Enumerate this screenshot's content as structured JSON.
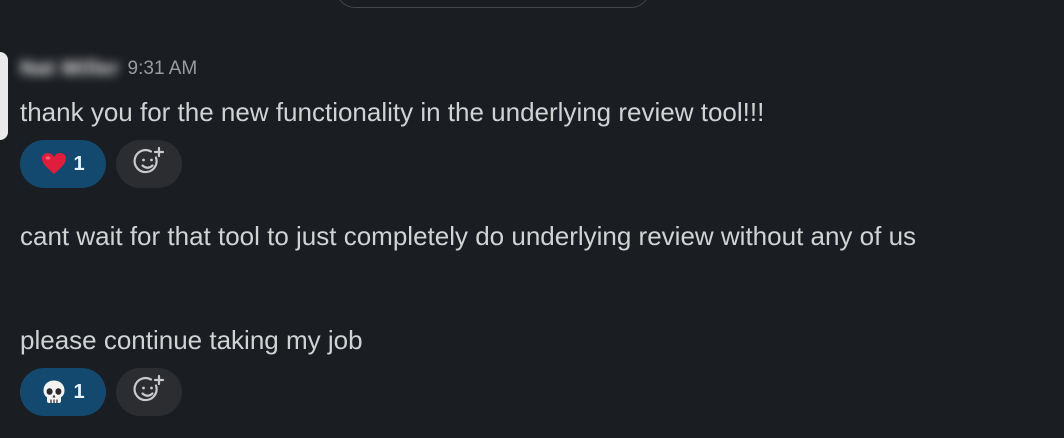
{
  "message": {
    "sender_name": "Nat Miller",
    "timestamp": "9:31 AM",
    "lines": [
      "thank you for the new functionality in the underlying review tool!!!",
      "cant wait for that tool to just completely do underlying review without any of us",
      "please continue taking my job"
    ]
  },
  "reactions": [
    {
      "emoji": "heart-icon",
      "count": "1"
    },
    {
      "emoji": "skull-icon",
      "count": "1"
    }
  ],
  "colors": {
    "background": "#1a1d21",
    "reaction_pill": "#13496e",
    "add_reaction_pill": "#2c2d31",
    "heart": "#e01e3c"
  }
}
